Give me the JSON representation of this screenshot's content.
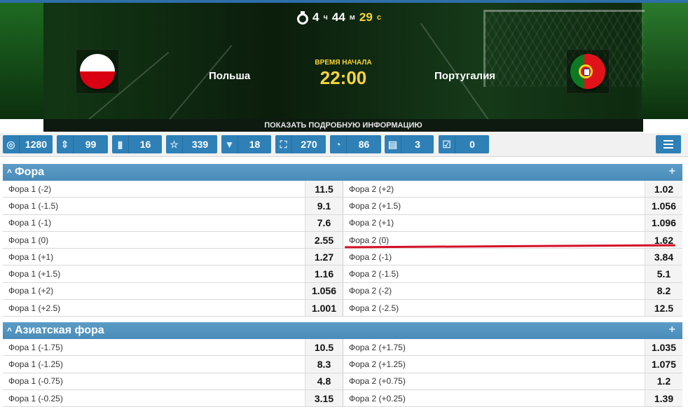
{
  "timer": {
    "hours": "4",
    "hours_unit": "ч",
    "minutes": "44",
    "minutes_unit": "м",
    "seconds": "29",
    "seconds_unit": "с"
  },
  "match": {
    "home_team": "Польша",
    "away_team": "Португалия",
    "start_label": "ВРЕМЯ НАЧАЛА",
    "start_time": "22:00"
  },
  "details_link": "ПОКАЗАТЬ ПОДРОБНУЮ ИНФОРМАЦИЮ",
  "stats": [
    {
      "icon": "target-icon",
      "value": "1280"
    },
    {
      "icon": "sort-arrows-icon",
      "value": "99"
    },
    {
      "icon": "bar-chart-icon",
      "value": "16"
    },
    {
      "icon": "star-icon",
      "value": "339"
    },
    {
      "icon": "shirt-icon",
      "value": "18"
    },
    {
      "icon": "goal-net-icon",
      "value": "270"
    },
    {
      "icon": "stopwatch-icon",
      "value": "86"
    },
    {
      "icon": "cards-icon",
      "value": "3"
    },
    {
      "icon": "checkbox-icon",
      "value": "0"
    }
  ],
  "sections": [
    {
      "title": "Фора",
      "rows": [
        {
          "l_label": "Фора 1 (-2)",
          "l_odd": "11.5",
          "r_label": "Фора 2 (+2)",
          "r_odd": "1.02"
        },
        {
          "l_label": "Фора 1 (-1.5)",
          "l_odd": "9.1",
          "r_label": "Фора 2 (+1.5)",
          "r_odd": "1.056"
        },
        {
          "l_label": "Фора 1 (-1)",
          "l_odd": "7.6",
          "r_label": "Фора 2 (+1)",
          "r_odd": "1.096"
        },
        {
          "l_label": "Фора 1 (0)",
          "l_odd": "2.55",
          "r_label": "Фора 2 (0)",
          "r_odd": "1.62"
        },
        {
          "l_label": "Фора 1 (+1)",
          "l_odd": "1.27",
          "r_label": "Фора 2 (-1)",
          "r_odd": "3.84"
        },
        {
          "l_label": "Фора 1 (+1.5)",
          "l_odd": "1.16",
          "r_label": "Фора 2 (-1.5)",
          "r_odd": "5.1"
        },
        {
          "l_label": "Фора 1 (+2)",
          "l_odd": "1.056",
          "r_label": "Фора 2 (-2)",
          "r_odd": "8.2"
        },
        {
          "l_label": "Фора 1 (+2.5)",
          "l_odd": "1.001",
          "r_label": "Фора 2 (-2.5)",
          "r_odd": "12.5"
        }
      ]
    },
    {
      "title": "Азиатская фора",
      "rows": [
        {
          "l_label": "Фора 1 (-1.75)",
          "l_odd": "10.5",
          "r_label": "Фора 2 (+1.75)",
          "r_odd": "1.035"
        },
        {
          "l_label": "Фора 1 (-1.25)",
          "l_odd": "8.3",
          "r_label": "Фора 2 (+1.25)",
          "r_odd": "1.075"
        },
        {
          "l_label": "Фора 1 (-0.75)",
          "l_odd": "4.8",
          "r_label": "Фора 2 (+0.75)",
          "r_odd": "1.2"
        },
        {
          "l_label": "Фора 1 (-0.25)",
          "l_odd": "3.15",
          "r_label": "Фора 2 (+0.25)",
          "r_odd": "1.39"
        }
      ]
    }
  ],
  "colors": {
    "accent": "#2e80b6",
    "section_header": "#4f90bc",
    "highlight": "#f7d53a",
    "annotation": "#d4112a"
  }
}
